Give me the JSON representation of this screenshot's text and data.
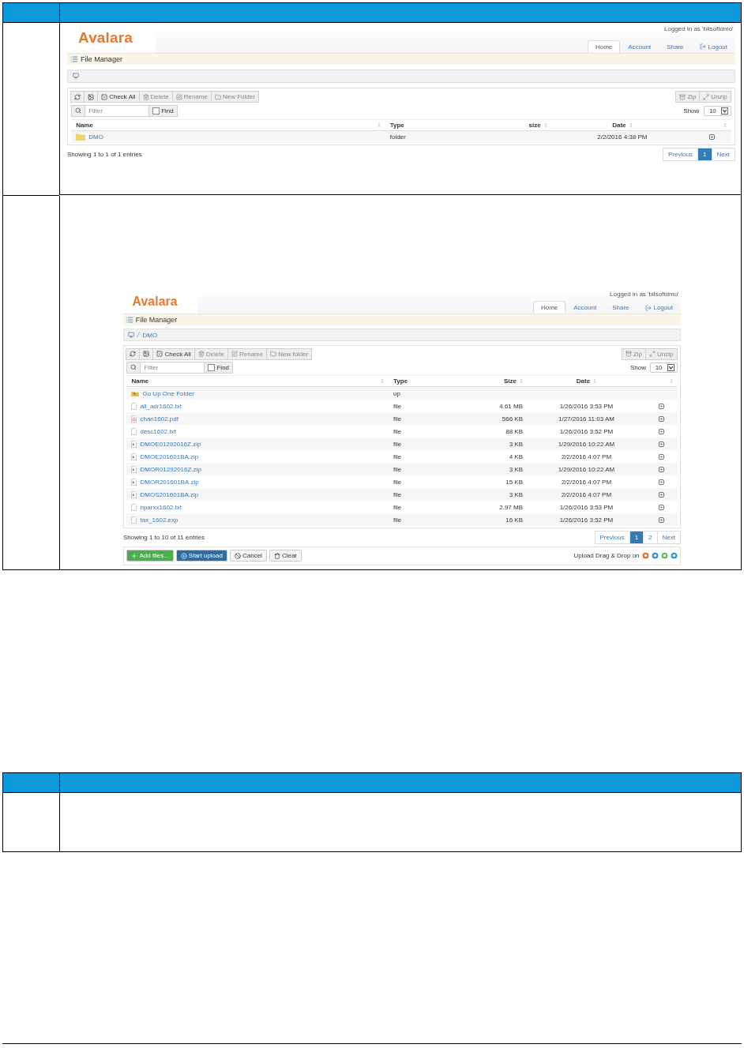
{
  "steps_table": {
    "rows": [
      {
        "screenshot": {
          "logo": "Avalara",
          "logged_in": "Logged in as 'bilsoftdmo'",
          "nav": [
            {
              "label": "Home",
              "selected": true
            },
            {
              "label": "Account",
              "selected": false
            },
            {
              "label": "Share",
              "selected": false
            },
            {
              "label": "Logout",
              "selected": false,
              "kind": "logout"
            }
          ],
          "title": "File Manager",
          "toolbar": [
            {
              "label": "Check All",
              "kind": "check",
              "disabled": false
            },
            {
              "label": "Delete",
              "kind": "delete",
              "disabled": true
            },
            {
              "label": "Rename",
              "kind": "rename",
              "disabled": true
            },
            {
              "label": "New Folder",
              "kind": "folder",
              "disabled": true
            }
          ],
          "archive_tools": [
            {
              "label": "Zip",
              "kind": "zip",
              "disabled": true
            },
            {
              "label": "Unzip",
              "kind": "unzip",
              "disabled": true
            }
          ],
          "filter": {
            "placeholder": "Filter"
          },
          "find": {
            "label": "Find",
            "checked": false
          },
          "show": {
            "label": "Show",
            "value": "10"
          },
          "columns": [
            "Name",
            "Type",
            "size",
            "Date"
          ],
          "rows": [
            {
              "kind": "folder",
              "name": "DMO",
              "type": "folder",
              "date": "2/2/2016 4:38 PM"
            }
          ],
          "info": "Showing 1 to 1 of 1 entries",
          "pages": [
            {
              "label": "Previous",
              "selected": false
            },
            {
              "label": "1",
              "selected": true
            },
            {
              "label": "Next",
              "selected": false
            }
          ]
        }
      },
      {
        "screenshot": {
          "logo": "Avalara",
          "logged_in": "Logged in as 'bilsoftdmo'",
          "nav": [
            {
              "label": "Home",
              "selected": true
            },
            {
              "label": "Account",
              "selected": false
            },
            {
              "label": "Share",
              "selected": false
            },
            {
              "label": "Logout",
              "selected": false,
              "kind": "logout"
            }
          ],
          "title": "File Manager",
          "breadcrumb": [
            "DMO"
          ],
          "toolbar": [
            {
              "label": "Check All",
              "kind": "check",
              "disabled": false
            },
            {
              "label": "Delete",
              "kind": "delete",
              "disabled": true
            },
            {
              "label": "Rename",
              "kind": "rename",
              "disabled": true
            },
            {
              "label": "New folder",
              "kind": "folder",
              "disabled": true
            }
          ],
          "archive_tools": [
            {
              "label": "Zip",
              "kind": "zip",
              "disabled": true
            },
            {
              "label": "Unzip",
              "kind": "unzip",
              "disabled": true
            }
          ],
          "filter": {
            "placeholder": "Filter"
          },
          "find": {
            "label": "Find",
            "checked": false
          },
          "show": {
            "label": "Show",
            "value": "10"
          },
          "columns": [
            "Name",
            "Type",
            "Size",
            "Date"
          ],
          "rows": [
            {
              "kind": "up",
              "name": "Go Up One Folder",
              "type": "up"
            },
            {
              "kind": "text",
              "name": "all_adr1602.txt",
              "type": "file",
              "size": "4.61 MB",
              "date": "1/26/2016 3:53 PM"
            },
            {
              "kind": "pdf",
              "name": "chan1602.pdf",
              "type": "file",
              "size": "566 KB",
              "date": "1/27/2016 11:03 AM"
            },
            {
              "kind": "text",
              "name": "desc1602.txt",
              "type": "file",
              "size": "88 KB",
              "date": "1/26/2016 3:52 PM"
            },
            {
              "kind": "zip",
              "name": "DMOE01292016Z.zip",
              "type": "file",
              "size": "3 KB",
              "date": "1/29/2016 10:22 AM"
            },
            {
              "kind": "zip",
              "name": "DMOE201601BA.zip",
              "type": "file",
              "size": "4 KB",
              "date": "2/2/2016 4:07 PM"
            },
            {
              "kind": "zip",
              "name": "DMOR01292016Z.zip",
              "type": "file",
              "size": "3 KB",
              "date": "1/29/2016 10:22 AM"
            },
            {
              "kind": "zip",
              "name": "DMOR201601BA.zip",
              "type": "file",
              "size": "15 KB",
              "date": "2/2/2016 4:07 PM"
            },
            {
              "kind": "zip",
              "name": "DMOS201601BA.zip",
              "type": "file",
              "size": "3 KB",
              "date": "2/2/2016 4:07 PM"
            },
            {
              "kind": "text",
              "name": "nparxx1602.txt",
              "type": "file",
              "size": "2.97 MB",
              "date": "1/26/2016 3:53 PM"
            },
            {
              "kind": "text",
              "name": "tax_1602.exp",
              "type": "file",
              "size": "16 KB",
              "date": "1/26/2016 3:52 PM"
            }
          ],
          "info": "Showing 1 to 10 of 11 entries",
          "pages": [
            {
              "label": "Previous",
              "selected": false
            },
            {
              "label": "1",
              "selected": true
            },
            {
              "label": "2",
              "selected": false
            },
            {
              "label": "Next",
              "selected": false
            }
          ],
          "upload": {
            "buttons": [
              {
                "label": "Add files...",
                "kind": "add"
              },
              {
                "label": "Start upload",
                "kind": "start"
              },
              {
                "label": "Cancel",
                "kind": "cancel"
              },
              {
                "label": "Clear",
                "kind": "clear"
              }
            ],
            "note": "Upload Drag & Drop on"
          }
        }
      }
    ]
  }
}
